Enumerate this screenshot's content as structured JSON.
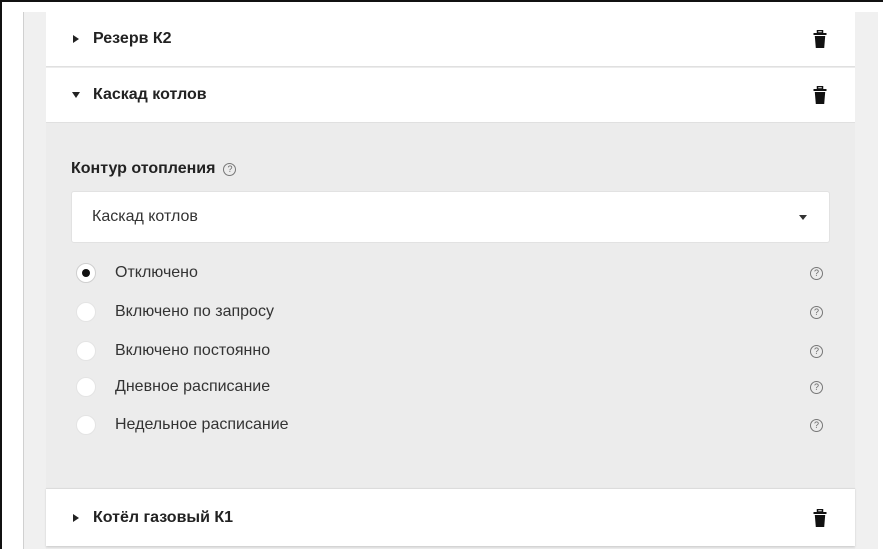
{
  "accordion": {
    "items": [
      {
        "title": "Резерв К2",
        "expanded": false
      },
      {
        "title": "Каскад котлов",
        "expanded": true
      },
      {
        "title": "Котёл газовый К1",
        "expanded": false
      }
    ]
  },
  "heating_circuit": {
    "label": "Контур отопления",
    "help_icon": "question-circle-icon",
    "select_value": "Каскад котлов"
  },
  "modes": [
    {
      "label": "Отключено",
      "checked": true
    },
    {
      "label": "Включено по запросу",
      "checked": false
    },
    {
      "label": "Включено постоянно",
      "checked": false
    },
    {
      "label": "Дневное расписание",
      "checked": false
    },
    {
      "label": "Недельное расписание",
      "checked": false
    }
  ],
  "icons": {
    "delete": "trash-icon",
    "collapsed": "caret-right-icon",
    "expanded": "caret-down-icon",
    "help": "question-circle-icon",
    "dropdown": "caret-down-icon"
  },
  "colors": {
    "panel_background": "#ececec",
    "header_background": "#ffffff",
    "text": "#222222"
  }
}
